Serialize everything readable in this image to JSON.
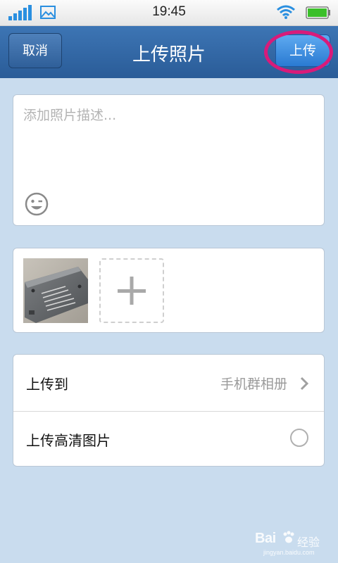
{
  "status_bar": {
    "time": "19:45",
    "icons": [
      "signal-icon",
      "image-icon",
      "wifi-icon",
      "battery-icon"
    ]
  },
  "header": {
    "title": "上传照片",
    "cancel_label": "取消",
    "upload_label": "上传",
    "highlight_color": "#d81b7a"
  },
  "description": {
    "placeholder": "添加照片描述...",
    "emoji_icon": "smiley-wink-icon"
  },
  "photos": {
    "thumbnail_icon": "photo-thumbnail",
    "add_icon": "plus-icon"
  },
  "settings": {
    "upload_to_label": "上传到",
    "upload_to_value": "手机群相册",
    "hd_label": "上传高清图片",
    "hd_enabled": false
  },
  "watermark": {
    "brand": "Bai",
    "jingyan": "经验",
    "url": "jingyan.baidu.com"
  },
  "colors": {
    "header_blue": "#2f64a3",
    "page_bg": "#c9dcee",
    "upload_button": "#3d8ee0"
  }
}
